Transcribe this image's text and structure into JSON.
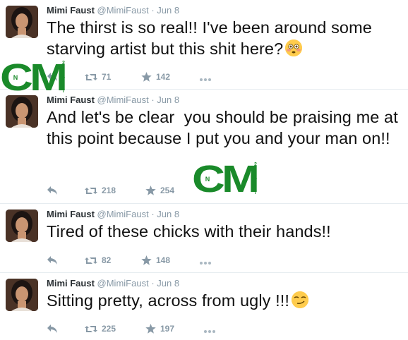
{
  "tweets": [
    {
      "name": "Mimi Faust",
      "handle": "@MimiFaust",
      "separator": "·",
      "date": "Jun 8",
      "text": "The thirst is so real!! I've been around some starving artist but this shit here?",
      "emoji": "flushed-face",
      "retweets": "71",
      "favorites": "142"
    },
    {
      "name": "Mimi Faust",
      "handle": "@MimiFaust",
      "separator": "·",
      "date": "Jun 8",
      "text": "And let's be clear  you should be praising me at this point because I put you and your man on!!",
      "emoji": "",
      "retweets": "218",
      "favorites": "254"
    },
    {
      "name": "Mimi Faust",
      "handle": "@MimiFaust",
      "separator": "·",
      "date": "Jun 8",
      "text": "Tired of these chicks with their hands!!",
      "emoji": "",
      "retweets": "82",
      "favorites": "148"
    },
    {
      "name": "Mimi Faust",
      "handle": "@MimiFaust",
      "separator": "·",
      "date": "Jun 8",
      "text": "Sitting pretty, across from ugly !!!",
      "emoji": "smirking-face",
      "retweets": "225",
      "favorites": "197"
    }
  ],
  "watermark": {
    "logo_text": "CM",
    "circle_letter": "N",
    "side_digits": [
      "2",
      "4",
      "7"
    ],
    "color": "#1a8a2a"
  },
  "icons": {
    "reply": "reply-icon",
    "retweet": "retweet-icon",
    "favorite": "star-icon",
    "more": "more-icon"
  },
  "colors": {
    "text": "#111111",
    "meta": "#8899a6",
    "divider": "#e6ecf0",
    "emoji": "#ffcc4d"
  }
}
